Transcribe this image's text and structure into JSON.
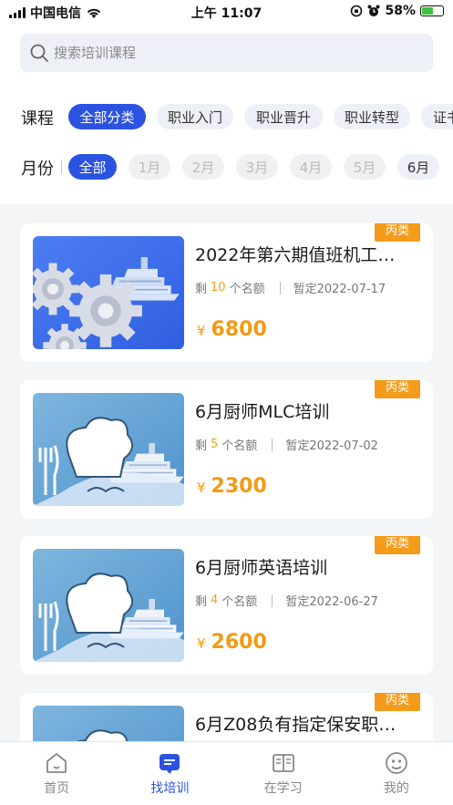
{
  "status_bar": {
    "carrier": "中国电信",
    "time": "上午 11:07",
    "battery_percent": "58%",
    "battery_level": 0.58
  },
  "search": {
    "placeholder": "搜索培训课程",
    "icon": "search-icon"
  },
  "course_filter": {
    "label": "课程",
    "options": [
      "全部分类",
      "职业入门",
      "职业晋升",
      "职业转型",
      "证书"
    ],
    "selected": "全部分类"
  },
  "month_filter": {
    "label": "月份",
    "options": [
      "全部",
      "1月",
      "2月",
      "3月",
      "4月",
      "5月",
      "6月"
    ],
    "selected": "全部",
    "disabled": [
      "1月",
      "2月",
      "3月",
      "4月",
      "5月"
    ]
  },
  "courses": [
    {
      "title": "2022年第六期值班机工…",
      "remaining_prefix": "剩",
      "remaining": "10",
      "remaining_suffix": "个名额",
      "date": "暂定2022-07-17",
      "currency": "¥",
      "price": "6800",
      "tag": "丙类",
      "thumb": "gears-ship"
    },
    {
      "title": "6月厨师MLC培训",
      "remaining_prefix": "剩",
      "remaining": "5",
      "remaining_suffix": "个名额",
      "date": "暂定2022-07-02",
      "currency": "¥",
      "price": "2300",
      "tag": "丙类",
      "thumb": "chef-ship"
    },
    {
      "title": "6月厨师英语培训",
      "remaining_prefix": "剩",
      "remaining": "4",
      "remaining_suffix": "个名额",
      "date": "暂定2022-06-27",
      "currency": "¥",
      "price": "2600",
      "tag": "丙类",
      "thumb": "chef-ship"
    },
    {
      "title": "6月Z08负有指定保安职…",
      "tag": "丙类",
      "thumb": "chef-ship"
    }
  ],
  "tabbar": {
    "items": [
      {
        "label": "首页",
        "icon": "home-icon"
      },
      {
        "label": "找培训",
        "icon": "find-training-icon"
      },
      {
        "label": "在学习",
        "icon": "book-icon"
      },
      {
        "label": "我的",
        "icon": "profile-icon"
      }
    ],
    "active": "找培训"
  },
  "colors": {
    "accent": "#2b52e0",
    "price": "#f09b16",
    "tag": "#f59b1a"
  }
}
